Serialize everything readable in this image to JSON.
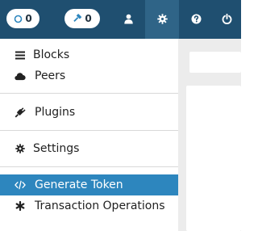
{
  "topbar": {
    "peers_count": "0",
    "blocks_count": "0",
    "icons": {
      "peers": "circle-outline-icon",
      "blocks": "hammer-icon",
      "user": "user-icon",
      "settings": "gear-icon",
      "help": "question-circle-icon",
      "power": "power-icon"
    }
  },
  "menu": {
    "items": [
      {
        "label": "Blocks",
        "icon": "bars-icon"
      },
      {
        "label": "Peers",
        "icon": "cloud-icon"
      },
      {
        "label": "Plugins",
        "icon": "plug-icon"
      },
      {
        "label": "Settings",
        "icon": "gear-icon"
      },
      {
        "label": "Generate Token",
        "icon": "code-icon",
        "active": true
      },
      {
        "label": "Transaction Operations",
        "icon": "asterisk-icon"
      }
    ]
  },
  "colors": {
    "topbar": "#1f4f70",
    "topbar_active": "#2f6487",
    "menu_active": "#2d86be",
    "right_pane": "#ececec"
  }
}
